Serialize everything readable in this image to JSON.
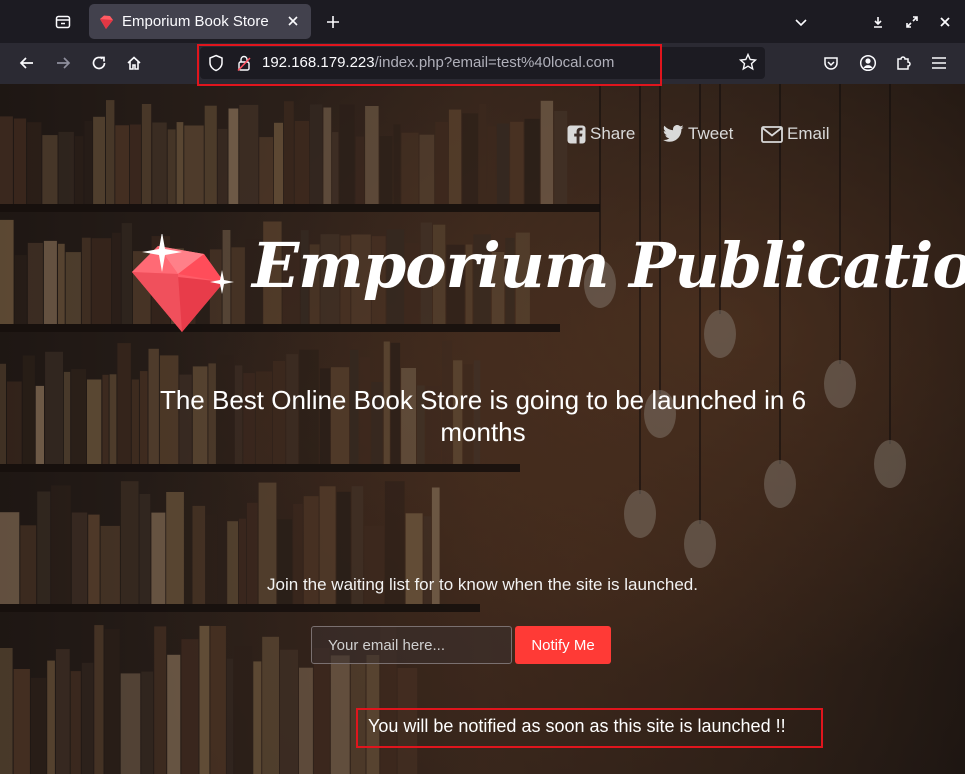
{
  "browser": {
    "tab_title": "Emporium Book Store",
    "url_host": "192.168.179.223",
    "url_path": "/index.php?email=test%40local.com",
    "icons": {
      "tab_list": "tab-list-icon",
      "new_tab": "plus-icon",
      "list_all_tabs": "chevron-down-icon",
      "back": "arrow-left-icon",
      "forward": "arrow-right-icon",
      "reload": "reload-icon",
      "home": "home-icon",
      "shield": "shield-icon",
      "lock": "lock-icon",
      "bookmark": "star-icon",
      "pocket": "pocket-icon",
      "account": "account-icon",
      "extensions": "puzzle-icon",
      "menu": "hamburger-icon"
    },
    "highlight_color": "#e0151d"
  },
  "page": {
    "social": {
      "share_label": "Share",
      "tweet_label": "Tweet",
      "email_label": "Email"
    },
    "brand": {
      "title": "Emporium Publications",
      "gem_color": "#ff4d5a"
    },
    "tagline": "The Best Online Book Store is going to be launched in 6 months",
    "waitlist_text": "Join the waiting list for to know when the site is launched.",
    "form": {
      "email_placeholder": "Your email here...",
      "email_value": "",
      "notify_label": "Notify Me",
      "button_color": "#ff3a36"
    },
    "notified_message": "You will be notified as soon as this site is launched !!"
  }
}
